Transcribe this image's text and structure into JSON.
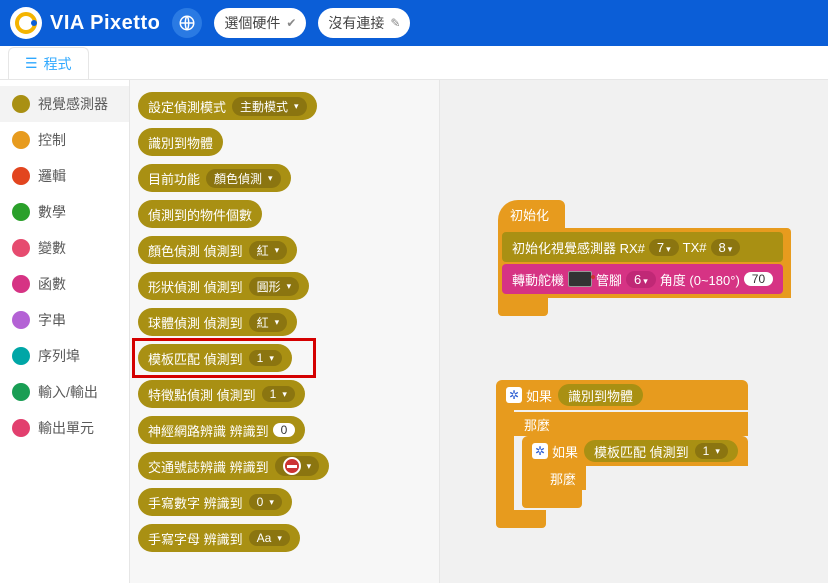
{
  "header": {
    "brand": "VIA Pixetto",
    "board_label": "選個硬件",
    "connect_label": "沒有連接"
  },
  "tabs": {
    "program": "程式"
  },
  "categories": [
    {
      "label": "視覺感測器",
      "color": "#a99013",
      "active": true
    },
    {
      "label": "控制",
      "color": "#e79b1e"
    },
    {
      "label": "邏輯",
      "color": "#e2451f"
    },
    {
      "label": "數學",
      "color": "#2aa02a"
    },
    {
      "label": "變數",
      "color": "#e64b6f"
    },
    {
      "label": "函數",
      "color": "#d63384"
    },
    {
      "label": "字串",
      "color": "#b462d5"
    },
    {
      "label": "序列埠",
      "color": "#00a6a6"
    },
    {
      "label": "輸入/輸出",
      "color": "#199e54"
    },
    {
      "label": "輸出單元",
      "color": "#e23f6e"
    }
  ],
  "palette": [
    {
      "label": "設定偵測模式",
      "drop": "主動模式"
    },
    {
      "label": "識別到物體"
    },
    {
      "label": "目前功能",
      "drop": "顏色偵測"
    },
    {
      "label": "偵測到的物件個數"
    },
    {
      "label": "顏色偵測 偵測到",
      "drop": "紅"
    },
    {
      "label": "形狀偵測 偵測到",
      "drop": "圓形"
    },
    {
      "label": "球體偵測 偵測到",
      "drop": "紅"
    },
    {
      "label": "模板匹配 偵測到",
      "drop": "1"
    },
    {
      "label": "特徵點偵測 偵測到",
      "drop": "1"
    },
    {
      "label": "神經網路辨識 辨識到",
      "oval": "0"
    },
    {
      "label": "交通號誌辨識 辨識到",
      "sign": true
    },
    {
      "label": "手寫數字 辨識到",
      "drop": "0"
    },
    {
      "label": "手寫字母 辨識到",
      "drop": "Aa"
    }
  ],
  "canvas": {
    "init": {
      "hat": "初始化",
      "vision_label": "初始化視覺感測器 RX#",
      "vision_rx": "7",
      "vision_tx_label": "TX#",
      "vision_tx": "8",
      "servo_label": "轉動舵機",
      "servo_pin_label": "管腳",
      "servo_pin": "6",
      "servo_angle_label": "角度 (0~180°)",
      "servo_angle": "70"
    },
    "logic": {
      "if": "如果",
      "cond1": "識別到物體",
      "then": "那麼",
      "cond2_label": "模板匹配 偵測到",
      "cond2_val": "1"
    }
  }
}
